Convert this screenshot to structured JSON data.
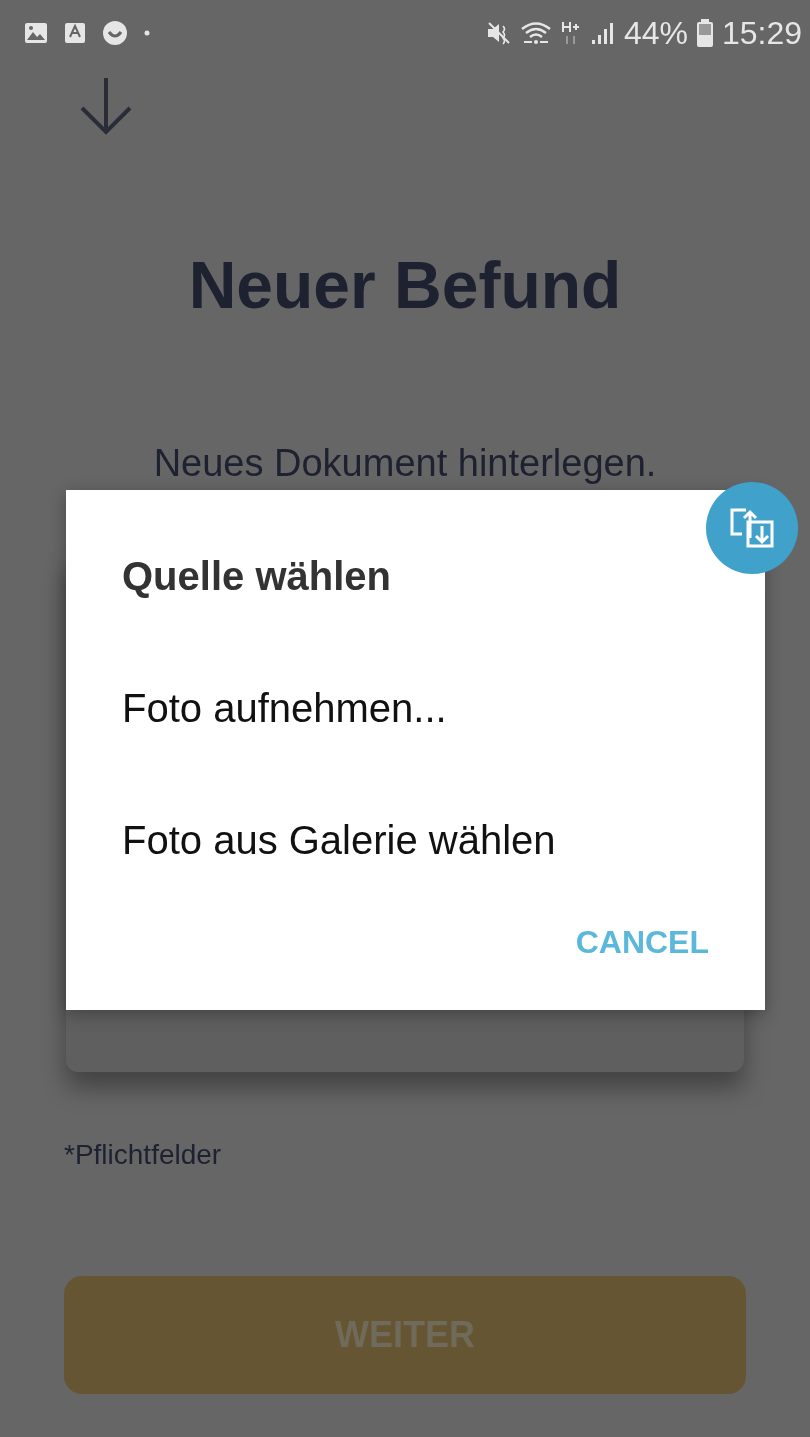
{
  "status_bar": {
    "battery": "44%",
    "time": "15:29"
  },
  "title": "Neuer Befund",
  "subtitle": "Neues Dokument hinterlegen.",
  "required_note": "*Pflichtfelder",
  "continue_button": {
    "label": "WEITER"
  },
  "dialog": {
    "title": "Quelle wählen",
    "options": [
      "Foto aufnehmen...",
      "Foto aus Galerie wählen"
    ],
    "cancel_button": "CANCEL"
  }
}
